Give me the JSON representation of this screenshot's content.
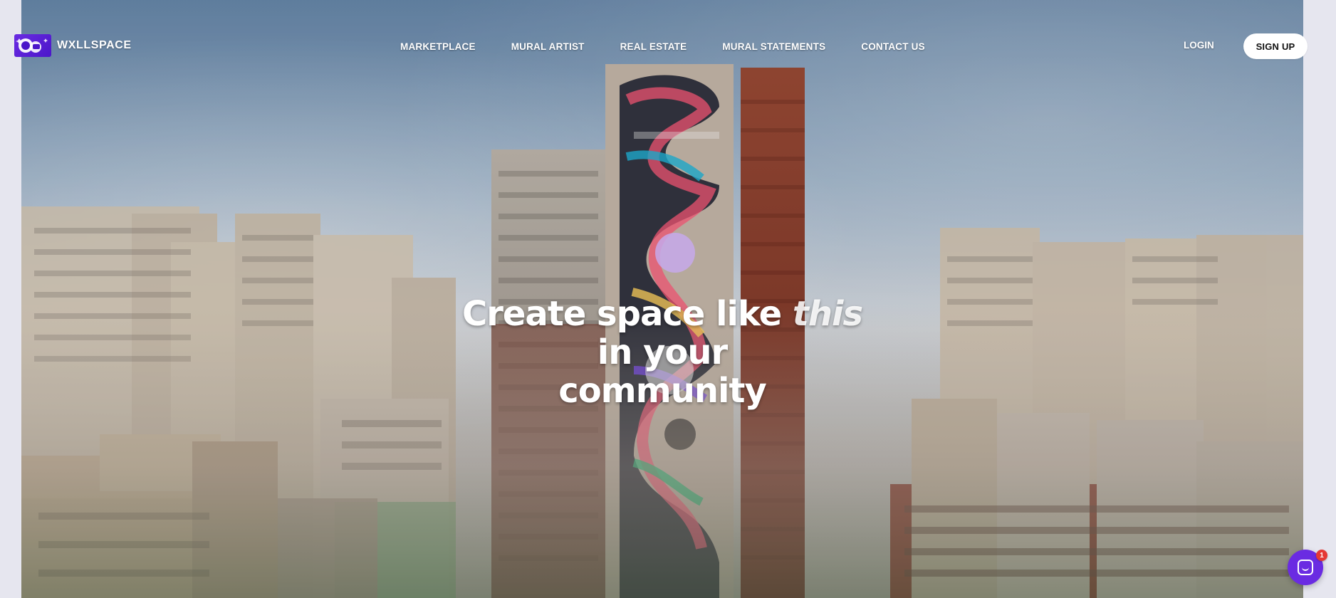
{
  "brand": {
    "name": "WXLLSPACE",
    "logo_icon": "astronaut-logo-icon",
    "accent": "#6a2be2"
  },
  "nav": {
    "items": [
      {
        "label": "MARKETPLACE"
      },
      {
        "label": "MURAL ARTIST"
      },
      {
        "label": "REAL ESTATE"
      },
      {
        "label": "MURAL STATEMENTS"
      },
      {
        "label": "CONTACT US"
      }
    ],
    "login_label": "LOGIN",
    "signup_label": "SIGN UP"
  },
  "hero": {
    "line1_prefix": "Create space like ",
    "line1_emphasis": "this",
    "line1_suffix": " in your",
    "line2": "community"
  },
  "chat": {
    "icon": "chat-icon",
    "badge_count": "1"
  }
}
